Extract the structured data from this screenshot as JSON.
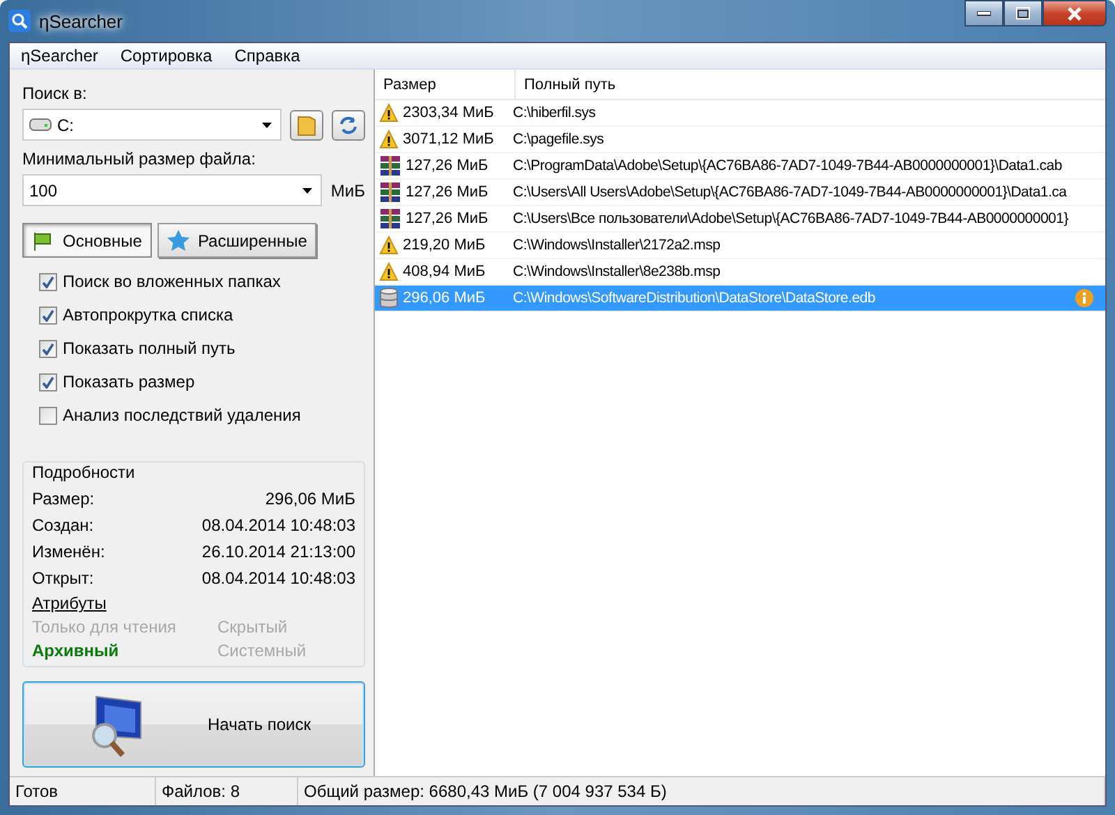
{
  "window": {
    "title": "ηSearcher"
  },
  "menu": [
    "ηSearcher",
    "Сортировка",
    "Справка"
  ],
  "search_in": {
    "label": "Поиск в:",
    "value": "C:"
  },
  "min_size": {
    "label": "Минимальный размер файла:",
    "value": "100",
    "unit": "МиБ"
  },
  "tabs": [
    {
      "label": "Основные",
      "selected": true,
      "kind": "flag"
    },
    {
      "label": "Расширенные",
      "selected": false,
      "kind": "star"
    }
  ],
  "options": [
    {
      "label": "Поиск во вложенных папках",
      "checked": true
    },
    {
      "label": "Автопрокрутка списка",
      "checked": true
    },
    {
      "label": "Показать полный путь",
      "checked": true
    },
    {
      "label": "Показать размер",
      "checked": true
    },
    {
      "label": "Анализ последствий удаления",
      "checked": false
    }
  ],
  "details": {
    "title": "Подробности",
    "fields": [
      {
        "label": "Размер:",
        "value": "296,06 МиБ"
      },
      {
        "label": "Создан:",
        "value": "08.04.2014 10:48:03"
      },
      {
        "label": "Изменён:",
        "value": "26.10.2014 21:13:00"
      },
      {
        "label": "Открыт:",
        "value": "08.04.2014 10:48:03"
      }
    ],
    "attributes_link": "Атрибуты",
    "attributes": [
      {
        "label": "Только для чтения",
        "active": false
      },
      {
        "label": "Скрытый",
        "active": false
      },
      {
        "label": "Архивный",
        "active": true
      },
      {
        "label": "Системный",
        "active": false
      }
    ]
  },
  "start_button": "Начать поиск",
  "table": {
    "columns": [
      "Размер",
      "Полный путь"
    ],
    "rows": [
      {
        "kind": "warning",
        "size": "2303,34 МиБ",
        "path": "C:\\hiberfil.sys",
        "selected": false,
        "info": false
      },
      {
        "kind": "warning",
        "size": "3071,12 МиБ",
        "path": "C:\\pagefile.sys",
        "selected": false,
        "info": false
      },
      {
        "kind": "archive",
        "size": "127,26 МиБ",
        "path": "C:\\ProgramData\\Adobe\\Setup\\{AC76BA86-7AD7-1049-7B44-AB0000000001}\\Data1.cab",
        "selected": false,
        "info": false
      },
      {
        "kind": "archive",
        "size": "127,26 МиБ",
        "path": "C:\\Users\\All Users\\Adobe\\Setup\\{AC76BA86-7AD7-1049-7B44-AB0000000001}\\Data1.ca",
        "selected": false,
        "info": false
      },
      {
        "kind": "archive",
        "size": "127,26 МиБ",
        "path": "C:\\Users\\Все пользователи\\Adobe\\Setup\\{AC76BA86-7AD7-1049-7B44-AB0000000001}",
        "selected": false,
        "info": false
      },
      {
        "kind": "warning",
        "size": "219,20 МиБ",
        "path": "C:\\Windows\\Installer\\2172a2.msp",
        "selected": false,
        "info": false
      },
      {
        "kind": "warning",
        "size": "408,94 МиБ",
        "path": "C:\\Windows\\Installer\\8e238b.msp",
        "selected": false,
        "info": false
      },
      {
        "kind": "database",
        "size": "296,06 МиБ",
        "path": "C:\\Windows\\SoftwareDistribution\\DataStore\\DataStore.edb",
        "selected": true,
        "info": true
      }
    ]
  },
  "status_bar": [
    "Готов",
    "Файлов: 8",
    "Общий размер: 6680,43 МиБ (7 004 937 534 Б)"
  ]
}
